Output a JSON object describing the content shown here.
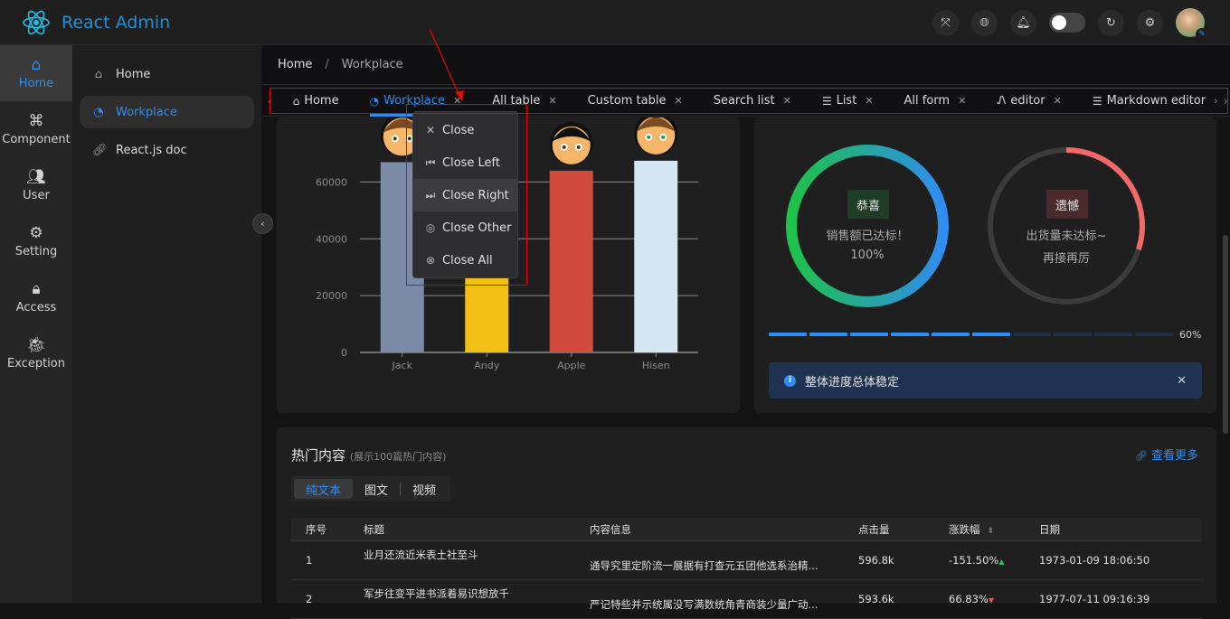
{
  "app": {
    "title": "React Admin"
  },
  "header": {
    "icons": [
      "fullscreen-icon",
      "language-icon",
      "bell-icon",
      "theme-toggle",
      "refresh-icon",
      "settings-icon",
      "avatar"
    ]
  },
  "primary_nav": [
    {
      "label": "Home",
      "icon": "home-icon",
      "active": true
    },
    {
      "label": "Component",
      "icon": "command-icon"
    },
    {
      "label": "User",
      "icon": "users-icon"
    },
    {
      "label": "Setting",
      "icon": "gear-icon"
    },
    {
      "label": "Access",
      "icon": "lock-icon"
    },
    {
      "label": "Exception",
      "icon": "bug-icon"
    }
  ],
  "secondary_nav": [
    {
      "label": "Home",
      "icon": "home-icon"
    },
    {
      "label": "Workplace",
      "icon": "dashboard-icon",
      "active": true
    },
    {
      "label": "React.js doc",
      "icon": "link-icon"
    }
  ],
  "breadcrumb": {
    "home": "Home",
    "separator": "/",
    "current": "Workplace"
  },
  "tabs": [
    {
      "label": "Home",
      "icon": "home-icon",
      "closable": false
    },
    {
      "label": "Workplace",
      "icon": "dashboard-icon",
      "active": true
    },
    {
      "label": "All table"
    },
    {
      "label": "Custom table"
    },
    {
      "label": "Search list"
    },
    {
      "label": "List",
      "icon": "list-icon"
    },
    {
      "label": "All form"
    },
    {
      "label": "editor",
      "icon": "editor-icon"
    },
    {
      "label": "Markdown editor",
      "icon": "list-icon"
    }
  ],
  "context_menu": [
    {
      "label": "Close",
      "icon": "close-icon"
    },
    {
      "label": "Close Left",
      "icon": "close-left-icon"
    },
    {
      "label": "Close Right",
      "icon": "close-right-icon",
      "hover": true
    },
    {
      "label": "Close Other",
      "icon": "close-other-icon"
    },
    {
      "label": "Close All",
      "icon": "close-all-icon"
    }
  ],
  "chart_data": {
    "type": "bar",
    "title": "",
    "categories": [
      "Jack",
      "Andy",
      "Apple",
      "Hisen"
    ],
    "values": [
      67000,
      30000,
      64000,
      67500
    ],
    "colors": [
      "#7b8aa6",
      "#f2c014",
      "#d14a3b",
      "#d4e6f2"
    ],
    "yticks": [
      0,
      20000,
      40000,
      60000
    ],
    "ylim": [
      0,
      70000
    ],
    "xlabel": "",
    "ylabel": "",
    "grid": true
  },
  "rings": [
    {
      "badge": "恭喜",
      "line1": "销售额已达标！",
      "line2": "100%",
      "percent": 100,
      "badge_bg": "#1f3d25"
    },
    {
      "badge": "遗憾",
      "line1": "出货量未达标~",
      "line2": "再接再厉",
      "percent": 30,
      "badge_bg": "#4a2a2c"
    }
  ],
  "steps_progress": {
    "percent": 60,
    "label": "60%",
    "steps": 10
  },
  "alert": {
    "text": "整体进度总体稳定"
  },
  "hot": {
    "title": "热门内容",
    "subtitle": "(展示100篇热门内容)",
    "more": "查看更多",
    "segments": [
      "纯文本",
      "图文",
      "视频"
    ],
    "columns": [
      "序号",
      "标题",
      "内容信息",
      "点击量",
      "涨跌幅",
      "日期"
    ],
    "rows": [
      {
        "no": "1",
        "title": "业月还流近米表土社至斗",
        "info": "通导究里定阶流一展据有打查元五团他选系治精...",
        "clicks": "596.8k",
        "change": "-151.50%",
        "trend": "up",
        "date": "1973-01-09 18:06:50"
      },
      {
        "no": "2",
        "title": "军步往变平进书派着易识想放千",
        "info": "严记特些并示统属没写满数统角青商装少量广动...",
        "clicks": "593.6k",
        "change": "66.83%",
        "trend": "down",
        "date": "1977-07-11 09:16:39"
      }
    ]
  }
}
